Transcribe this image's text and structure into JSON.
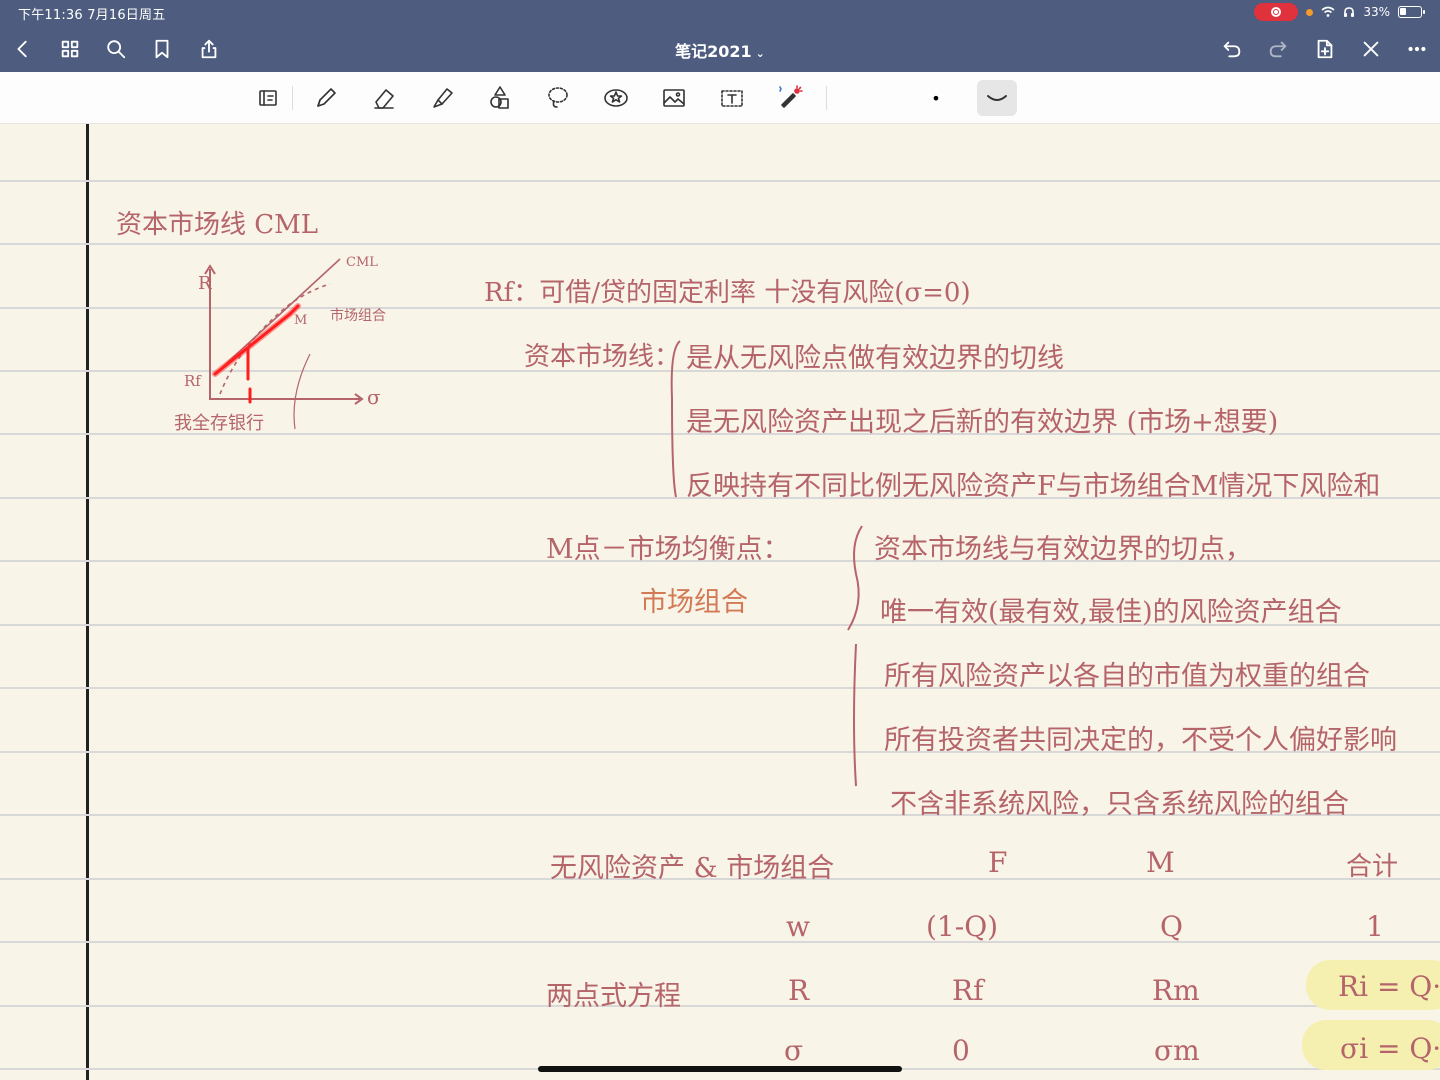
{
  "status": {
    "time": "下午11:36   7月16日周五",
    "battery": "33%"
  },
  "nav": {
    "title": "笔记2021",
    "title_caret": "⌄"
  },
  "toolbar": {
    "tools": [
      "page-thumb",
      "pen",
      "eraser",
      "highlighter",
      "shapes",
      "lasso",
      "sticker",
      "image",
      "text",
      "laser-pointer"
    ],
    "pen_size": "•"
  },
  "note": {
    "heading": "资本市场线 CML",
    "graph": {
      "y_axis": "R",
      "x_axis": "σ",
      "cml": "CML",
      "m_label": "M",
      "market_label": "市场组合",
      "rf_label": "Rf",
      "bottom_label": "我全存银行"
    },
    "rf_line": "Rf：可借/贷的固定利率 十没有风险(σ=0)",
    "cml_def": {
      "label": "资本市场线：",
      "items": [
        "是从无风险点做有效边界的切线",
        "是无风险资产出现之后新的有效边界 (市场+想要)",
        "反映持有不同比例无风险资产F与市场组合M情况下风险和"
      ]
    },
    "m_point": {
      "label": "M点－市场均衡点：",
      "sub": "市场组合",
      "items": [
        "资本市场线与有效边界的切点，",
        "唯一有效(最有效,最佳)的风险资产组合",
        "所有风险资产以各自的市值为权重的组合",
        "所有投资者共同决定的，不受个人偏好影响",
        "不含非系统风险，只含系统风险的组合"
      ]
    },
    "table": {
      "title": "无风险资产 & 市场组合",
      "headers": [
        "F",
        "M",
        "合计"
      ],
      "row_w": {
        "label": "w",
        "f": "(1-Q)",
        "m": "Q",
        "total": "1"
      },
      "section": "两点式方程",
      "row_r": {
        "label": "R",
        "f": "Rf",
        "m": "Rm",
        "formula": "Ri = Q·"
      },
      "row_s": {
        "label": "σ",
        "f": "0",
        "m": "σm",
        "formula": "σi = Q·σ"
      }
    }
  }
}
